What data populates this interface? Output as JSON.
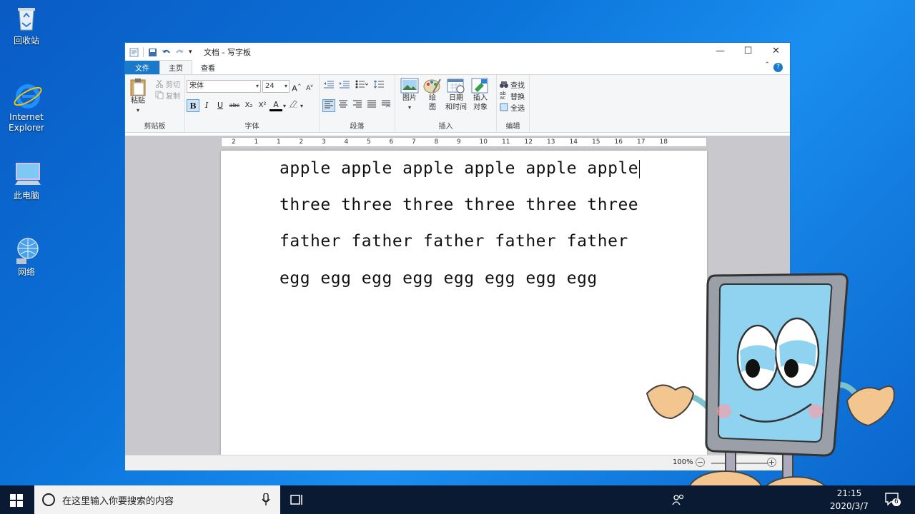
{
  "desktop": {
    "icons": [
      {
        "label": "回收站",
        "icon": "recycle-bin-icon"
      },
      {
        "label": "Internet Explorer",
        "icon": "internet-explorer-icon"
      },
      {
        "label": "此电脑",
        "icon": "this-pc-icon"
      },
      {
        "label": "网络",
        "icon": "network-icon"
      }
    ]
  },
  "window": {
    "title": "文档 - 写字板",
    "controls": {
      "minimize": "—",
      "maximize": "☐",
      "close": "✕"
    },
    "tabs": {
      "file": "文件",
      "home": "主页",
      "view": "查看"
    },
    "help": "?"
  },
  "ribbon": {
    "clipboard": {
      "name": "剪贴板",
      "paste": "粘贴",
      "cut": "剪切",
      "copy": "复制"
    },
    "font": {
      "name": "字体",
      "family": "宋体",
      "size": "24",
      "bold": "B",
      "italic": "I",
      "underline": "U",
      "strike": "abc",
      "subscript": "X₂",
      "superscript": "X²",
      "color": "A"
    },
    "paragraph": {
      "name": "段落"
    },
    "insert": {
      "name": "插入",
      "picture": "图片",
      "paint": "绘\n图",
      "datetime": "日期\n和时间",
      "object": "插入\n对象"
    },
    "editing": {
      "name": "编辑",
      "find": "查找",
      "replace": "替换",
      "select_all": "全选"
    }
  },
  "ruler": {
    "ticks": [
      "2",
      "1",
      "1",
      "2",
      "3",
      "4",
      "5",
      "6",
      "7",
      "8",
      "9",
      "10",
      "11",
      "12",
      "13",
      "14",
      "15",
      "16",
      "17",
      "18"
    ]
  },
  "document": {
    "lines": [
      "apple apple apple apple apple apple",
      "three three three three three three",
      "father father father father father",
      "egg egg egg egg egg egg egg egg"
    ]
  },
  "status": {
    "zoom": "100%",
    "minus": "−",
    "plus": "+"
  },
  "taskbar": {
    "search_placeholder": "在这里输入你要搜索的内容",
    "time": "21:15",
    "date": "2020/3/7",
    "notifications": "6"
  },
  "colors": {
    "accent": "#1979ca",
    "desktop": "#0b73d9",
    "taskbar": "#0a1a33"
  }
}
